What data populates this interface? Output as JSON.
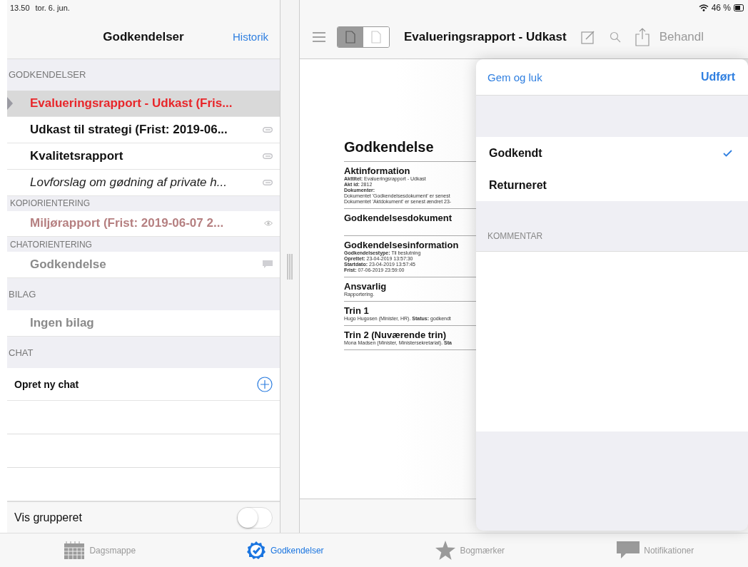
{
  "status_bar": {
    "time": "13.50",
    "date": "tor. 6. jun.",
    "battery": "46 %"
  },
  "left_nav": {
    "title": "Godkendelser",
    "action": "Historik"
  },
  "sections": [
    {
      "header": "GODKENDELSER",
      "kind": "main",
      "items": [
        {
          "title": "Evalueringsrapport - Udkast (Fris...",
          "kind": "urgent",
          "selected": true
        },
        {
          "title": "Udkast til strategi (Frist: 2019-06...",
          "kind": "attached",
          "selected": false
        },
        {
          "title": "Kvalitetsrapport",
          "kind": "attached",
          "selected": false
        },
        {
          "title": "Lovforslag om gødning af private h...",
          "kind": "proposal",
          "selected": false
        }
      ]
    },
    {
      "header": "KOPIORIENTERING",
      "kind": "sub",
      "items": [
        {
          "title": "Miljørapport (Frist: 2019-06-07 2...",
          "kind": "copy",
          "selected": false
        }
      ]
    },
    {
      "header": "CHATORIENTERING",
      "kind": "sub",
      "items": [
        {
          "title": "Godkendelse",
          "kind": "chat",
          "selected": false
        }
      ]
    },
    {
      "header": "BILAG",
      "kind": "main",
      "items": [
        {
          "title": "Ingen bilag",
          "kind": "empty",
          "selected": false
        }
      ]
    },
    {
      "header": "CHAT",
      "kind": "main",
      "items": [
        {
          "title": "Opret ny chat",
          "kind": "action",
          "selected": false
        }
      ]
    }
  ],
  "group_toggle": {
    "label": "Vis grupperet",
    "on": false
  },
  "toolbar": {
    "title": "Evalueringsrapport - Udkast",
    "segments": [
      {
        "selected": true
      },
      {
        "selected": false
      }
    ],
    "process": "Behandl"
  },
  "document": {
    "title": "Godkendelse",
    "sections": [
      {
        "heading": "Aktinformation",
        "lines": [
          "**Akttitel:** Evalueringsrapport - Udkast",
          "**Akt id:** 2812",
          "**Dokumenter:**",
          "Dokumentet 'Godkendelsesdokument' er senest",
          "Dokumentet 'Aktdokument' er senest ændret 23-"
        ]
      },
      {
        "heading": "Godkendelsesdokument"
      },
      {
        "heading": "Godkendelsesinformation",
        "lines": [
          "**Godkendelsestype:** Til beslutning",
          "**Oprettet:** 23-04-2019 13:57:30",
          "**Startdato:** 23-04-2019 13:57:45",
          "**Frist:** 07-06-2019 23:59:00"
        ]
      },
      {
        "heading": "Ansvarlig",
        "lines": [
          "Rapportering."
        ]
      },
      {
        "heading": "Trin 1",
        "lines": [
          "Hugo Hugosen (Minister, HR). **Status:** godkendt"
        ]
      },
      {
        "heading": "Trin 2 (Nuværende trin)",
        "lines": [
          "Mona Madsen (Minister, Ministersekretariat). **Sta**"
        ]
      }
    ]
  },
  "popover": {
    "cancel": "Gem og luk",
    "done": "Udført",
    "options": [
      {
        "label": "Godkendt",
        "selected": true
      },
      {
        "label": "Returneret",
        "selected": false
      }
    ],
    "comment_header": "KOMMENTAR"
  },
  "tabs": [
    {
      "label": "Dagsmappe",
      "kind": "calendar",
      "selected": false
    },
    {
      "label": "Godkendelser",
      "kind": "approvals",
      "selected": true
    },
    {
      "label": "Bogmærker",
      "kind": "bookmarks",
      "selected": false
    },
    {
      "label": "Notifikationer",
      "kind": "notifications",
      "selected": false
    }
  ]
}
